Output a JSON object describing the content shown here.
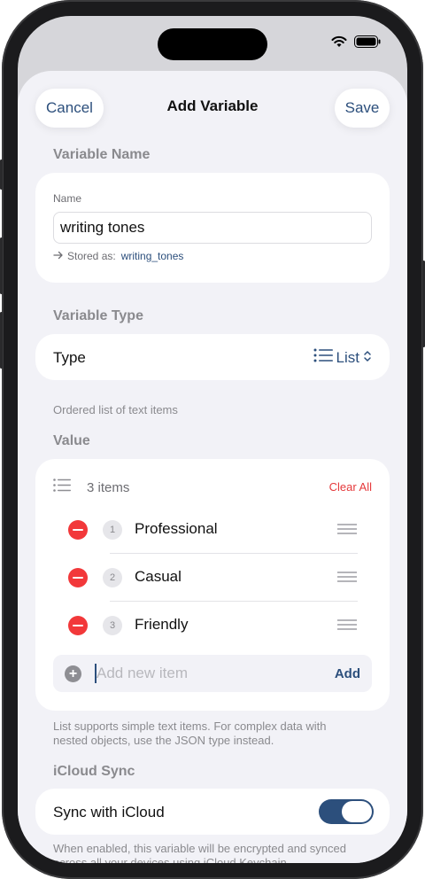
{
  "colors": {
    "accent": "#2c4f7c",
    "destructive": "#e5393b",
    "toggle_on": "#2c4f7c"
  },
  "nav": {
    "cancel": "Cancel",
    "title": "Add Variable",
    "save": "Save"
  },
  "variable_name": {
    "section": "Variable Name",
    "field_label": "Name",
    "value": "writing tones",
    "stored_prefix": "Stored as:",
    "stored_value": "writing_tones"
  },
  "variable_type": {
    "section": "Variable Type",
    "label": "Type",
    "value": "List",
    "caption": "Ordered list of text items"
  },
  "value": {
    "section": "Value",
    "count": "3 items",
    "clear_all": "Clear All",
    "items": [
      {
        "index": "1",
        "label": "Professional"
      },
      {
        "index": "2",
        "label": "Casual"
      },
      {
        "index": "3",
        "label": "Friendly"
      }
    ],
    "placeholder": "Add new item",
    "add": "Add",
    "caption_line1": "List supports simple text items. For complex data with",
    "caption_line2": "nested objects, use the JSON type instead."
  },
  "icloud": {
    "section": "iCloud Sync",
    "label": "Sync with iCloud",
    "enabled": true,
    "caption_line1": "When enabled, this variable will be encrypted and synced",
    "caption_line2": "across all your devices using iCloud Keychain."
  },
  "icons": [
    "wifi-icon",
    "battery-icon",
    "arrow-right-icon",
    "list-icon",
    "chevron-updown-icon",
    "minus-circle-icon",
    "drag-handle-icon",
    "plus-circle-icon"
  ]
}
